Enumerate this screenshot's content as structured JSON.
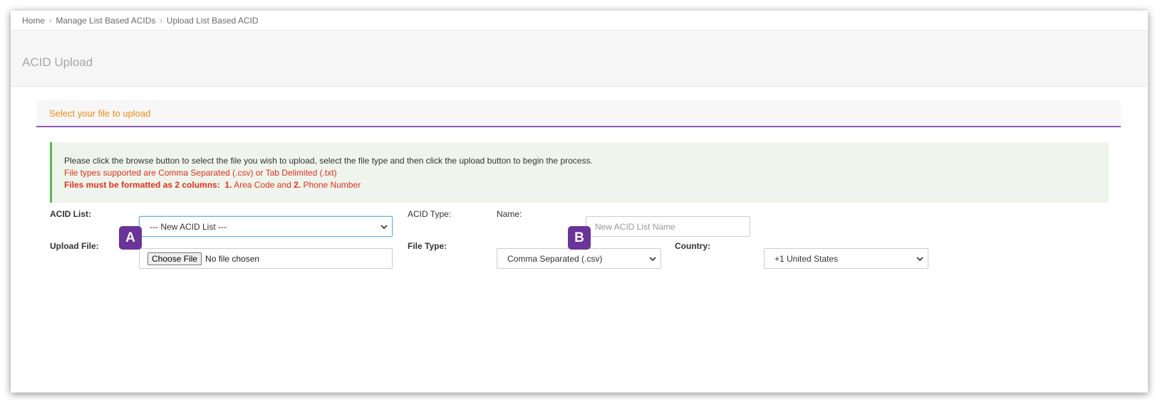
{
  "breadcrumb": {
    "items": [
      "Home",
      "Manage List Based ACIDs",
      "Upload List Based ACID"
    ]
  },
  "header": {
    "title": "ACID Upload"
  },
  "panel": {
    "title": "Select your file to upload"
  },
  "notice": {
    "line1": "Please click the browse button to select the file you wish to upload, select the file type and then click the upload button to begin the process.",
    "line2": "File types supported are Comma Separated (.csv) or Tab Delimited (.txt)",
    "line3_bold": "Files must be formatted as 2 columns:",
    "col1_num": "1.",
    "col1_label": "Area Code and",
    "col2_num": "2.",
    "col2_label": "Phone Number"
  },
  "form": {
    "acid_list_label": "ACID List:",
    "acid_list_value": "--- New ACID List ---",
    "acid_type_label": "ACID Type:",
    "name_label": "Name:",
    "name_placeholder": "New ACID List Name",
    "upload_file_label": "Upload File:",
    "choose_file_label": "Choose File",
    "file_status": "No file chosen",
    "file_type_label": "File Type:",
    "file_type_value": "Comma Separated (.csv)",
    "country_label": "Country:",
    "country_value": "+1 United States"
  },
  "annotations": {
    "a": "A",
    "b": "B"
  },
  "colors": {
    "accent_orange": "#ef8c14",
    "accent_purple": "#8e5db5",
    "badge_purple": "#6a3498",
    "notice_red": "#e0301e",
    "notice_green": "#59b452"
  }
}
